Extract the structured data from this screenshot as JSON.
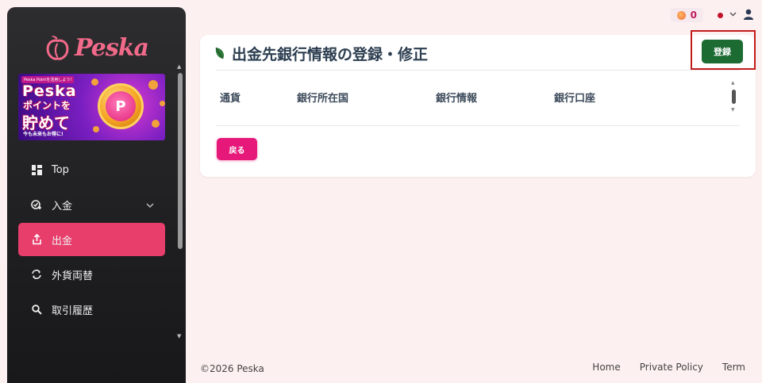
{
  "sidebar": {
    "logo_text": "Peska",
    "banner": {
      "top_tag": "Peska Pointを活用しよう!",
      "line1": "Peska",
      "line2": "ポイントを",
      "line3": "貯めて",
      "line4": "今も未来もお得に!",
      "coin_letter": "P"
    },
    "items": [
      {
        "label": "Top",
        "icon": "dashboard-icon"
      },
      {
        "label": "入金",
        "icon": "deposit-icon"
      },
      {
        "label": "出金",
        "icon": "withdraw-icon"
      },
      {
        "label": "外貨両替",
        "icon": "exchange-icon"
      },
      {
        "label": "取引履歴",
        "icon": "search-icon"
      }
    ]
  },
  "topbar": {
    "points": "0"
  },
  "card": {
    "title": "出金先銀行情報の登録・修正",
    "register_label": "登録",
    "columns": [
      "通貨",
      "銀行所在国",
      "銀行情報",
      "銀行口座"
    ],
    "back_label": "戻る"
  },
  "footer": {
    "copyright": "©2026 Peska",
    "links": [
      "Home",
      "Private Policy",
      "Term"
    ]
  },
  "colors": {
    "accent": "#e83e6c",
    "register": "#1b6b32",
    "highlight_box": "#c21b1b",
    "back_button": "#e6197a"
  }
}
